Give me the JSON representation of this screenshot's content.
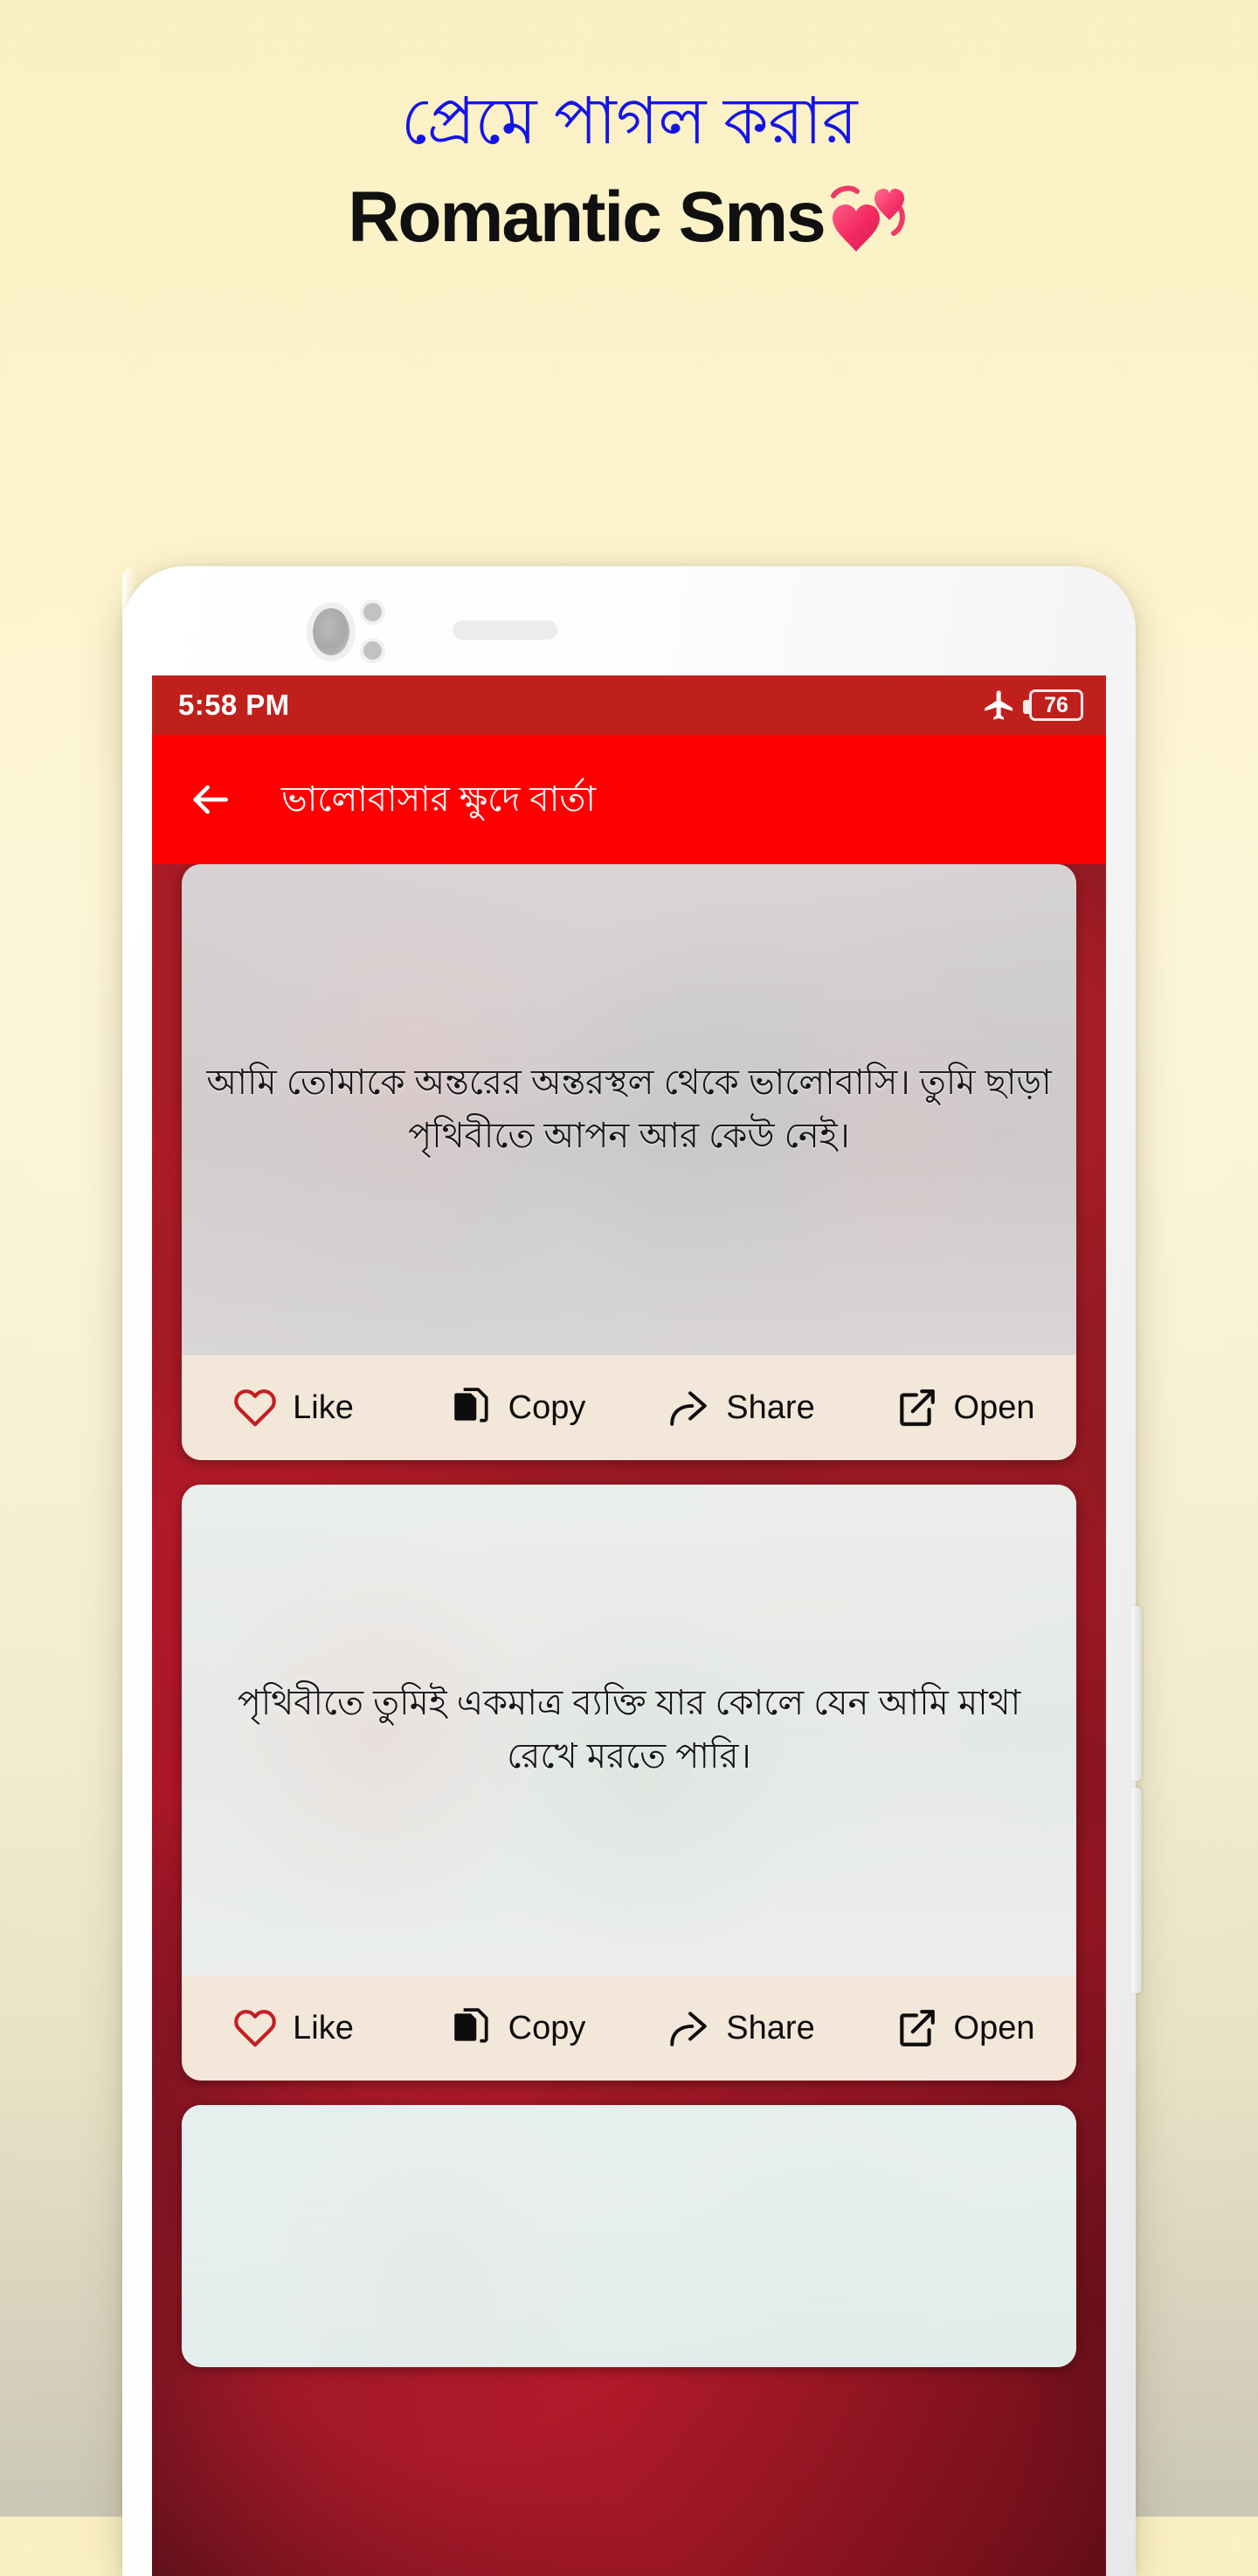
{
  "promo": {
    "headline_bn": "প্রেমে পাগল করার",
    "headline_en": "Romantic Sms",
    "heart_emoji": "two-hearts-emoji",
    "colors": {
      "headline_bn_color": "#1414E6",
      "headline_en_color": "#101010",
      "background_top": "#FBF0C4",
      "background_bottom": "#CBC7B6"
    }
  },
  "phone": {
    "hardware": {
      "camera_lens": "front-camera-icon",
      "sensor_dot_1": "proximity-sensor-icon",
      "sensor_dot_2": "light-sensor-icon",
      "earpiece": "earpiece-speaker",
      "volume_button": "volume-rocker",
      "power_button": "power-button"
    }
  },
  "statusbar": {
    "time": "5:58 PM",
    "airplane_icon": "airplane-mode-icon",
    "battery_level": "76",
    "bg_color": "#C0201C"
  },
  "appbar": {
    "back_icon": "back-arrow-icon",
    "title": "ভালোবাসার ক্ষুদে বার্তা",
    "bg_color": "#FF0000"
  },
  "actions": {
    "like": {
      "label": "Like",
      "icon": "heart-outline-icon",
      "color": "#C41E23"
    },
    "copy": {
      "label": "Copy",
      "icon": "copy-document-icon",
      "color": "#0D0D0D"
    },
    "share": {
      "label": "Share",
      "icon": "share-arrow-icon",
      "color": "#0D0D0D"
    },
    "open": {
      "label": "Open",
      "icon": "external-link-icon",
      "color": "#0D0D0D"
    },
    "bar_bg": "#F3E7D9"
  },
  "cards": [
    {
      "text": "আমি তোমাকে অন্তরের অন্তরস্থল থেকে ভালোবাসি। তুমি ছাড়া পৃথিবীতে আপন আর কেউ নেই।"
    },
    {
      "text": "পৃথিবীতে তুমিই একমাত্র ব্যক্তি যার কোলে যেন আমি মাথা রেখে মরতে পারি।"
    },
    {
      "text": ""
    }
  ]
}
